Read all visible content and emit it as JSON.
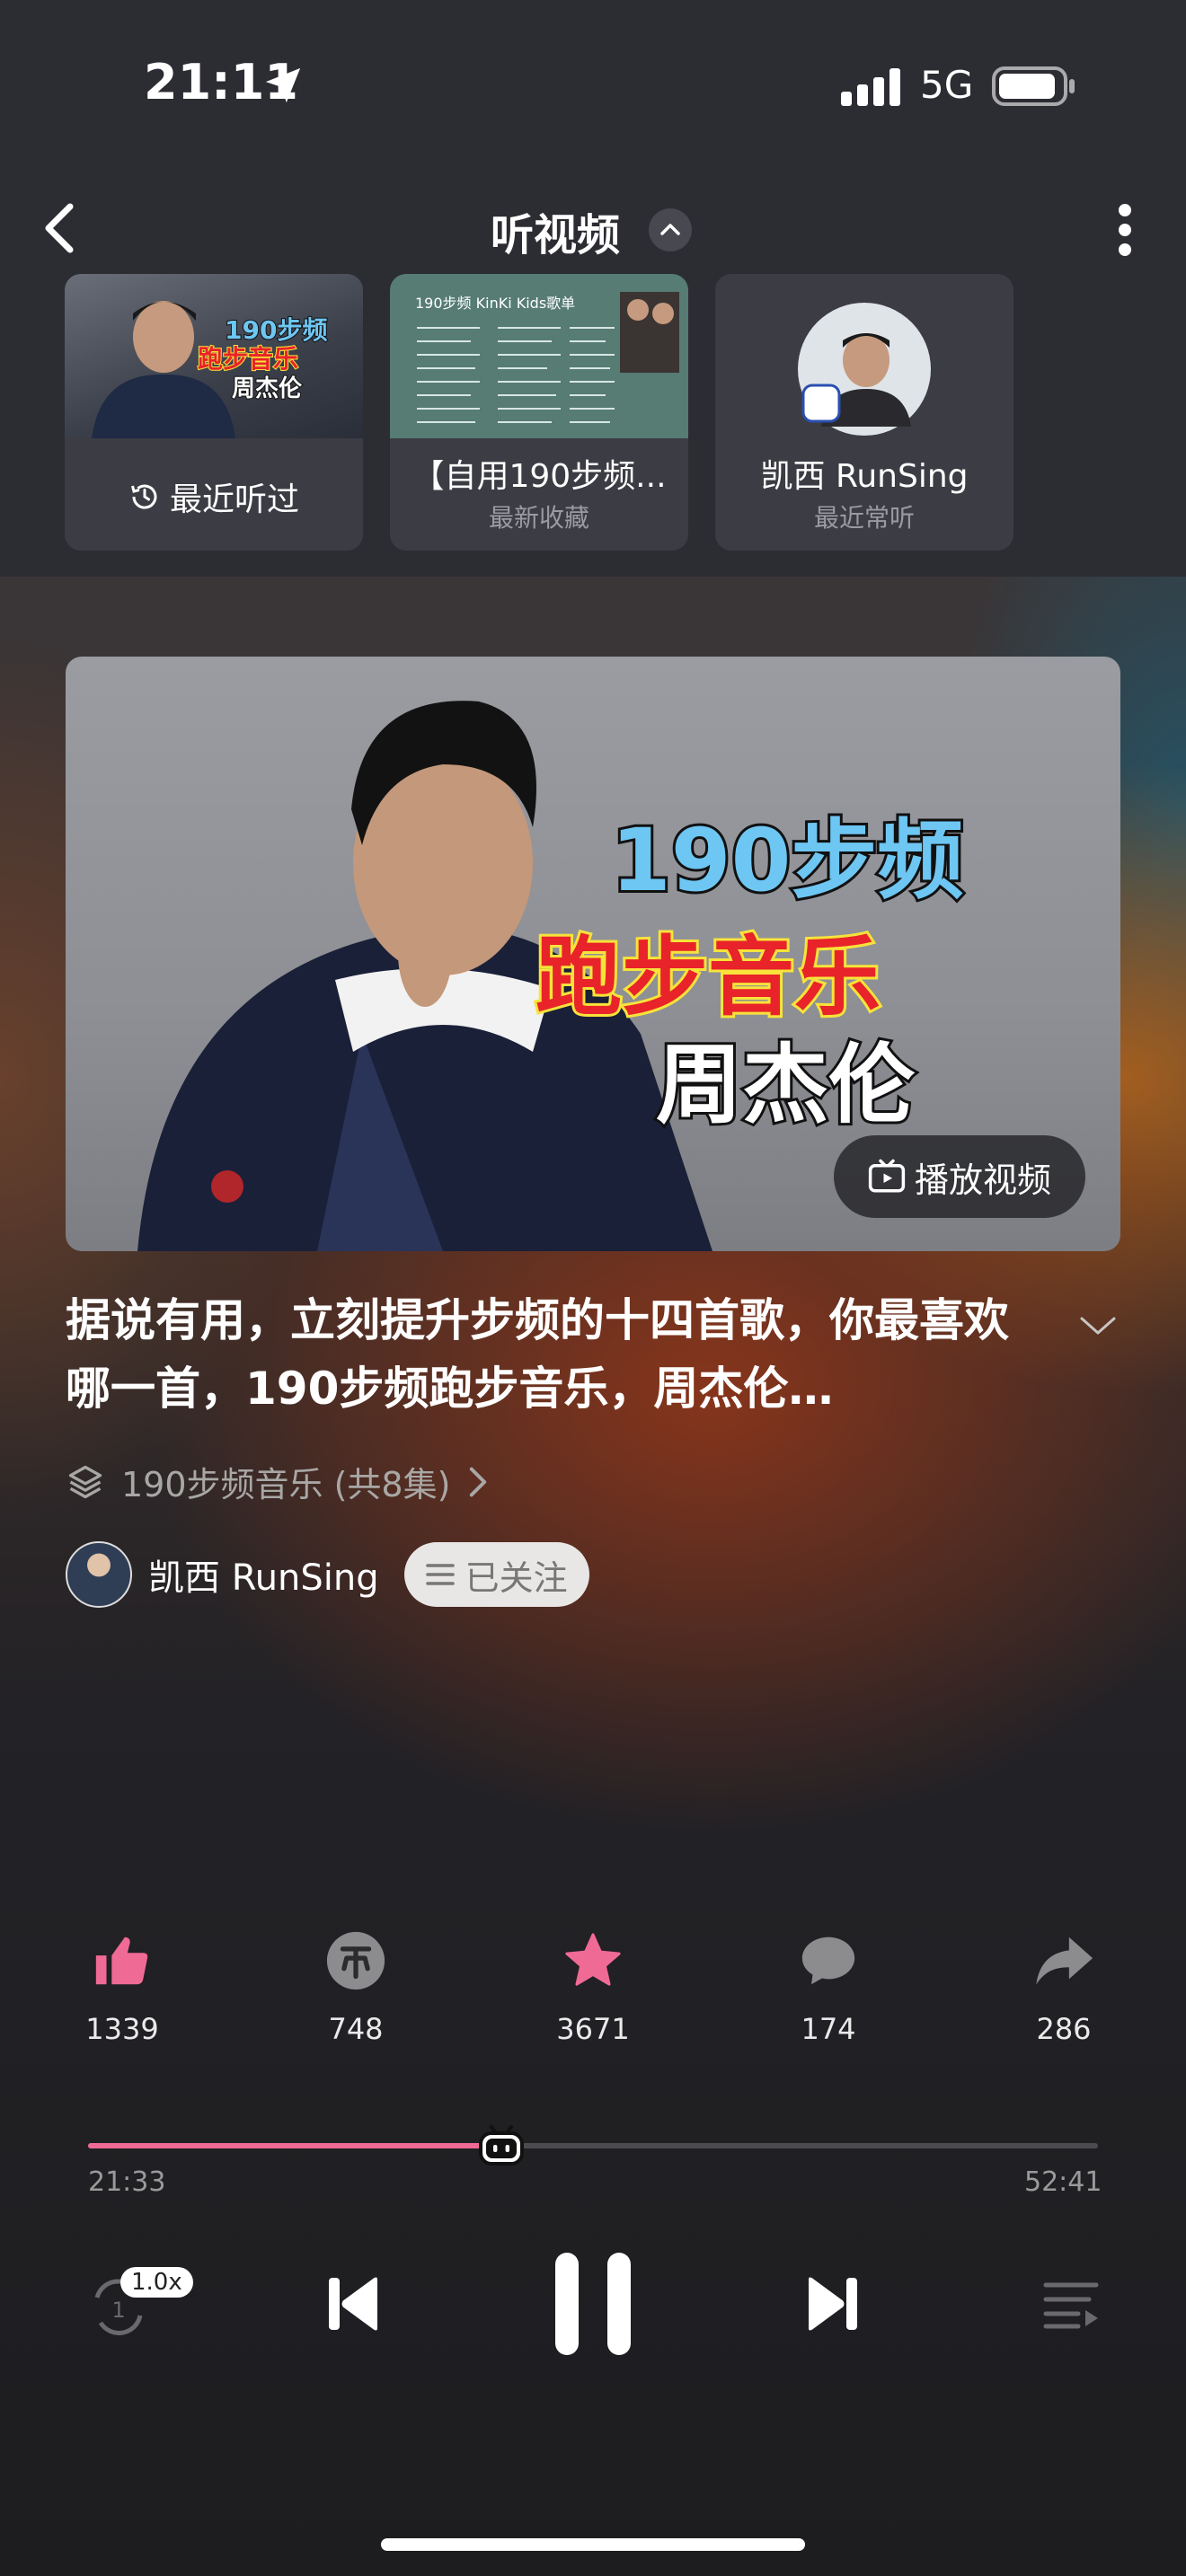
{
  "status": {
    "time": "21:11",
    "network": "5G"
  },
  "header": {
    "title": "听视频"
  },
  "recent_cards": [
    {
      "label": "最近听过",
      "thumb_line1": "190步频",
      "thumb_line2": "跑步音乐",
      "thumb_line3": "周杰伦"
    },
    {
      "title": "【自用190步频...",
      "subtitle": "最新收藏",
      "thumb_heading": "190步频 KinKi Kids歌单"
    },
    {
      "title": "凯西 RunSing",
      "subtitle": "最近常听"
    }
  ],
  "cover": {
    "line1": "190步频",
    "line2": "跑步音乐",
    "line3": "周杰伦",
    "play_video_label": "播放视频"
  },
  "song": {
    "title": "据说有用，立刻提升步频的十四首歌，你最喜欢哪一首，190步频跑步音乐，周杰伦…",
    "series": "190步频音乐 (共8集)"
  },
  "author": {
    "name": "凯西 RunSing",
    "follow_label": "已关注"
  },
  "actions": [
    {
      "icon": "thumb-up-icon",
      "count": "1339",
      "color": "#f06a96"
    },
    {
      "icon": "coin-icon",
      "count": "748",
      "color": "#8c8b8e"
    },
    {
      "icon": "star-icon",
      "count": "3671",
      "color": "#f06a96"
    },
    {
      "icon": "comment-icon",
      "count": "174",
      "color": "#8c8b8e"
    },
    {
      "icon": "share-icon",
      "count": "286",
      "color": "#8c8b8e"
    }
  ],
  "playback": {
    "current_time": "21:33",
    "total_time": "52:41",
    "progress": 0.409,
    "speed": "1.0x",
    "loop_count": "1"
  },
  "colors": {
    "accent": "#f06a96"
  }
}
